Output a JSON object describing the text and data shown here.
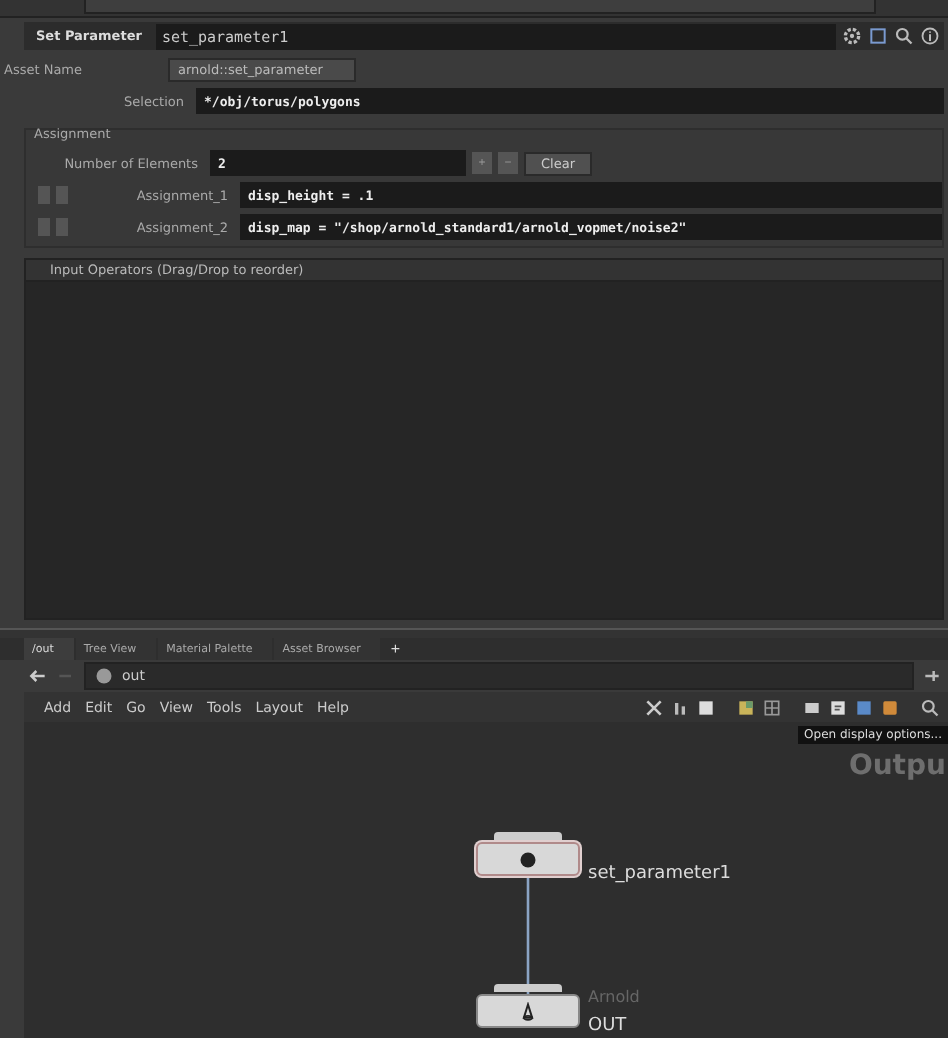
{
  "parameter_editor": {
    "node_type": "Set Parameter",
    "node_name": "set_parameter1",
    "asset_name": {
      "label": "Asset Name",
      "value": "arnold::set_parameter"
    },
    "selection": {
      "label": "Selection",
      "value": "*/obj/torus/polygons"
    },
    "assignment": {
      "title": "Assignment",
      "count_label": "Number of Elements",
      "count": "2",
      "plus": "+",
      "minus": "−",
      "clear": "Clear",
      "items": [
        {
          "label": "Assignment_1",
          "value": "disp_height = .1"
        },
        {
          "label": "Assignment_2",
          "value": "disp_map = \"/shop/arnold_standard1/arnold_vopmet/noise2\""
        }
      ]
    },
    "input_operators": {
      "header": "Input Operators (Drag/Drop to reorder)"
    }
  },
  "network": {
    "tabs": [
      {
        "label": "/out",
        "selected": true
      },
      {
        "label": "Tree View",
        "selected": false
      },
      {
        "label": "Material Palette",
        "selected": false
      },
      {
        "label": "Asset Browser",
        "selected": false
      }
    ],
    "add_tab": "+",
    "path": "out",
    "menu": [
      "Add",
      "Edit",
      "Go",
      "View",
      "Tools",
      "Layout",
      "Help"
    ],
    "tooltip": "Open display options...",
    "context_label": "Outpu",
    "nodes": [
      {
        "name": "set_parameter1",
        "selected": true,
        "kind": "set"
      },
      {
        "type_label": "Arnold",
        "name": "OUT",
        "selected": false,
        "kind": "rop"
      }
    ]
  }
}
